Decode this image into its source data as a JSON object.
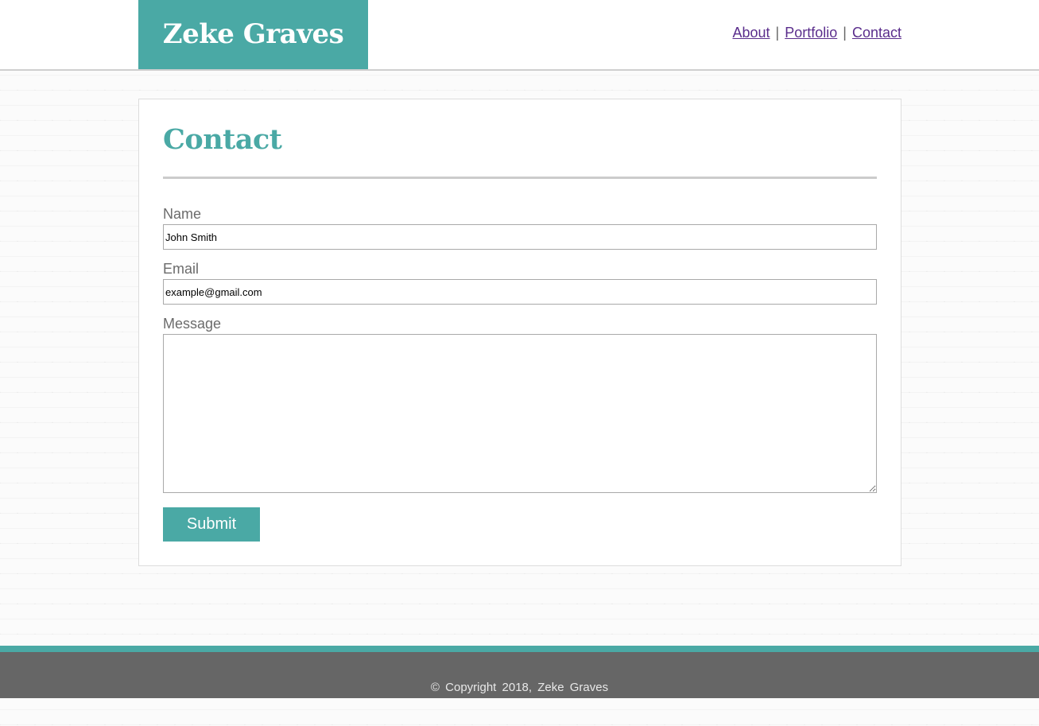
{
  "header": {
    "brand": "Zeke Graves",
    "nav": [
      {
        "label": "About"
      },
      {
        "label": "Portfolio"
      },
      {
        "label": "Contact"
      }
    ],
    "separator": "|"
  },
  "main": {
    "title": "Contact",
    "form": {
      "name_label": "Name",
      "name_value": "John Smith",
      "email_label": "Email",
      "email_value": "example@gmail.com",
      "message_label": "Message",
      "message_value": "",
      "submit_label": "Submit"
    }
  },
  "footer": {
    "copyright": "© Copyright 2018, Zeke Graves"
  },
  "colors": {
    "accent": "#4aa9a5",
    "link": "#5a2d8c",
    "footer_bg": "#666666"
  }
}
